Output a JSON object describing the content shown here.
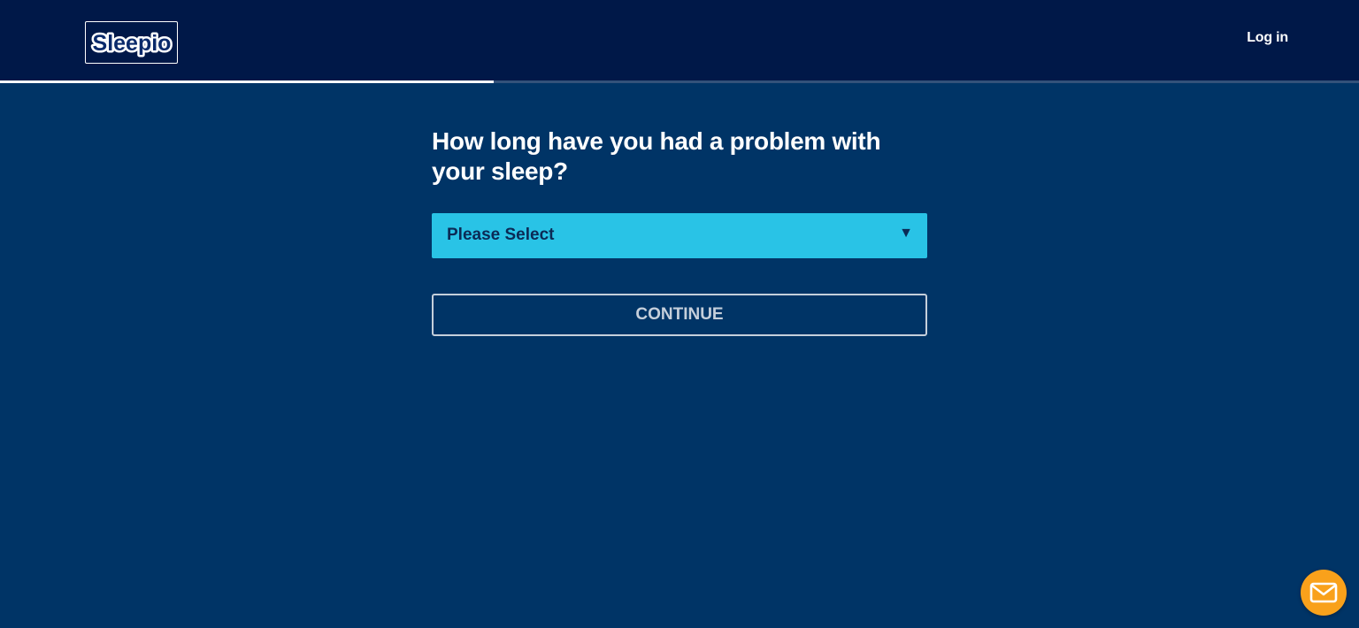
{
  "header": {
    "logo_text": "Sleepio",
    "login_label": "Log in"
  },
  "progress": {
    "fraction": 0.363
  },
  "question": {
    "title": "How long have you had a problem with your sleep?"
  },
  "select": {
    "selected": "Please Select",
    "arrow": "▼"
  },
  "actions": {
    "continue_label": "CONTINUE"
  },
  "chat": {
    "icon": "envelope-icon"
  },
  "colors": {
    "header_bg": "#001848",
    "page_bg": "#003466",
    "select_bg": "#29c3e6",
    "chat_bg": "#f9a11b"
  }
}
